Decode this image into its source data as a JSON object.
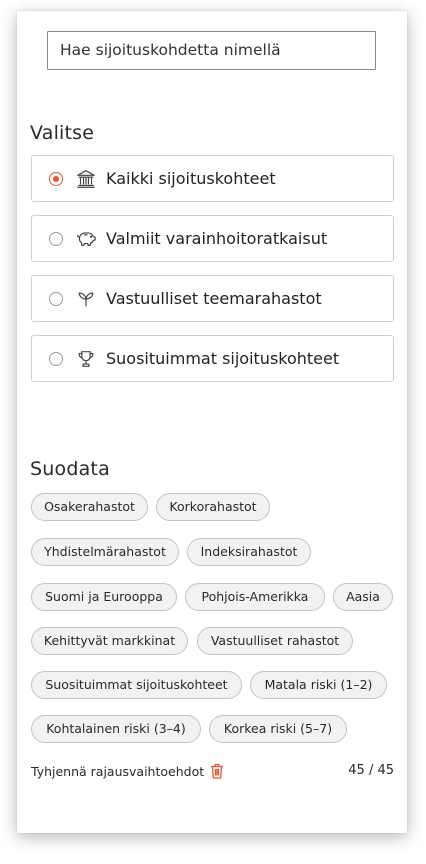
{
  "search": {
    "placeholder": "Hae sijoituskohdetta nimellä"
  },
  "choose": {
    "title": "Valitse",
    "options": [
      {
        "label": "Kaikki sijoituskohteet",
        "icon": "bank-icon",
        "selected": true
      },
      {
        "label": "Valmiit varainhoitoratkaisut",
        "icon": "piggy-bank-icon",
        "selected": false
      },
      {
        "label": "Vastuulliset teemarahastot",
        "icon": "sprout-icon",
        "selected": false
      },
      {
        "label": "Suosituimmat sijoituskohteet",
        "icon": "trophy-icon",
        "selected": false
      }
    ]
  },
  "filter": {
    "title": "Suodata",
    "chips": [
      "Osakerahastot",
      "Korkorahastot",
      "Yhdistelmärahastot",
      "Indeksirahastot",
      "Suomi ja Eurooppa",
      "Pohjois-Amerikka",
      "Aasia",
      "Kehittyvät markkinat",
      "Vastuulliset rahastot",
      "Suosituimmat sijoituskohteet",
      "Matala riski (1–2)",
      "Kohtalainen riski (3–4)",
      "Korkea riski (5–7)"
    ],
    "clear_label": "Tyhjennä rajausvaihtoehdot",
    "clear_icon": "trash-icon",
    "count": "45 / 45"
  },
  "colors": {
    "accent": "#e8542f",
    "chip_bg": "#f2f2f2",
    "border": "#cfcfcf"
  }
}
